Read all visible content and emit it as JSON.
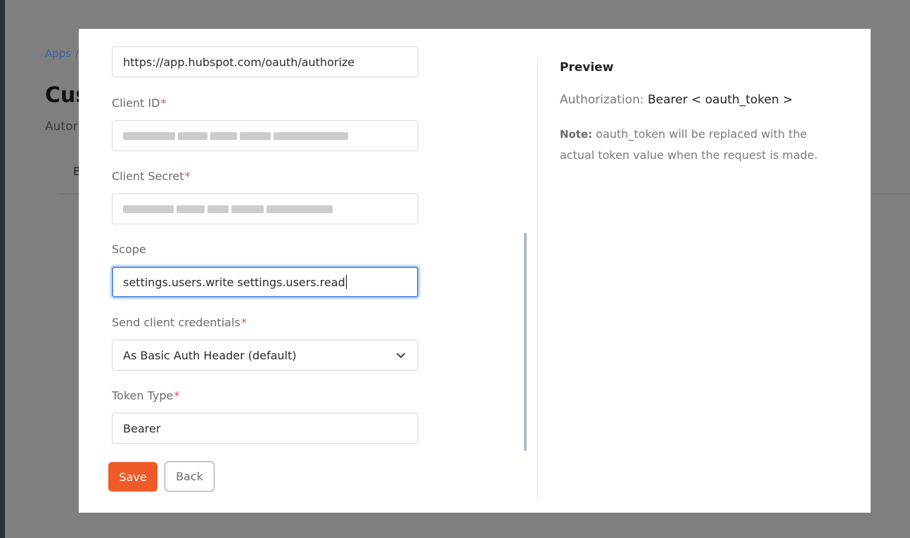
{
  "background": {
    "breadcrumb_root": "Apps",
    "breadcrumb_sep": "/",
    "title": "Cus",
    "subtitle": "Autor",
    "tab": "B"
  },
  "form": {
    "authorization_url": {
      "value": "https://app.hubspot.com/oauth/authorize"
    },
    "client_id": {
      "label": "Client ID",
      "required": "*",
      "value_masked": true
    },
    "client_secret": {
      "label": "Client Secret",
      "required": "*",
      "value_masked": true
    },
    "scope": {
      "label": "Scope",
      "value": "settings.users.write settings.users.read"
    },
    "send_client_credentials": {
      "label": "Send client credentials",
      "required": "*",
      "selected": "As Basic Auth Header (default)"
    },
    "token_type": {
      "label": "Token Type",
      "required": "*",
      "value": "Bearer"
    }
  },
  "actions": {
    "save_label": "Save",
    "back_label": "Back"
  },
  "preview": {
    "heading": "Preview",
    "auth_key": "Authorization:",
    "auth_value": "Bearer < oauth_token >",
    "note_label": "Note:",
    "note_text": "oauth_token will be replaced with the actual token value when the request is made."
  },
  "colors": {
    "primary": "#ef5a28",
    "required": "#e35252",
    "focus": "#5e8fde"
  },
  "icons": {
    "select": "chevron-down-icon"
  }
}
